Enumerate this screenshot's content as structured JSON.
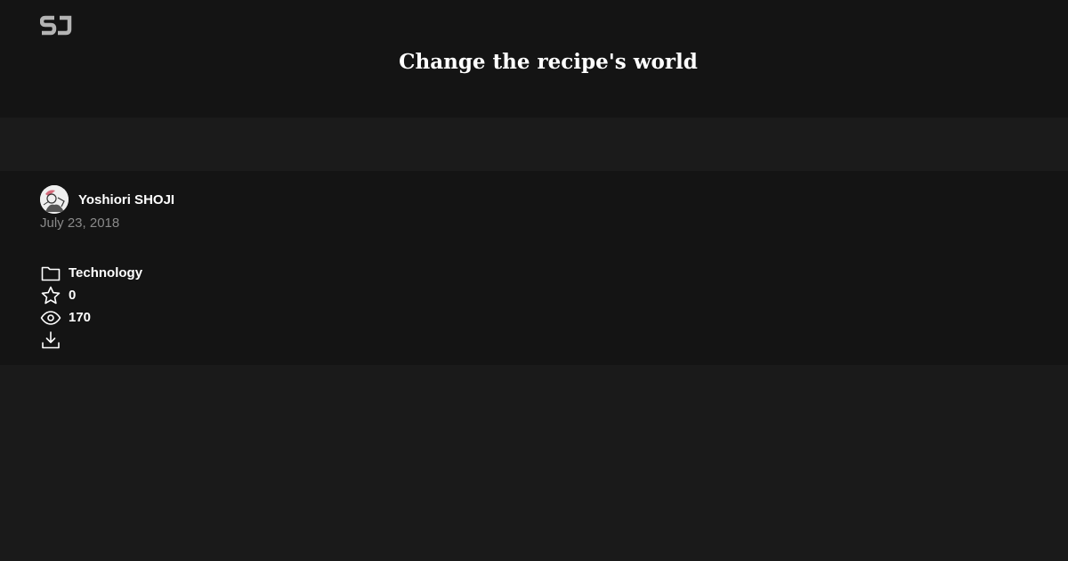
{
  "header": {
    "logo_icon": "sj-logo-icon",
    "title": "Change the recipe's world"
  },
  "author": {
    "name": "Yoshiori SHOJI",
    "avatar_icon": "avatar-illustration",
    "date": "July 23, 2018"
  },
  "meta": {
    "category_icon": "folder-icon",
    "category": "Technology",
    "stars_icon": "star-icon",
    "stars": "0",
    "views_icon": "eye-icon",
    "views": "170",
    "download_icon": "download-icon"
  },
  "colors": {
    "header_bg": "#141414",
    "page_bg": "#1a1a1a",
    "text": "#ffffff",
    "muted": "#8a8a8a",
    "logo": "#b4b4b4"
  }
}
